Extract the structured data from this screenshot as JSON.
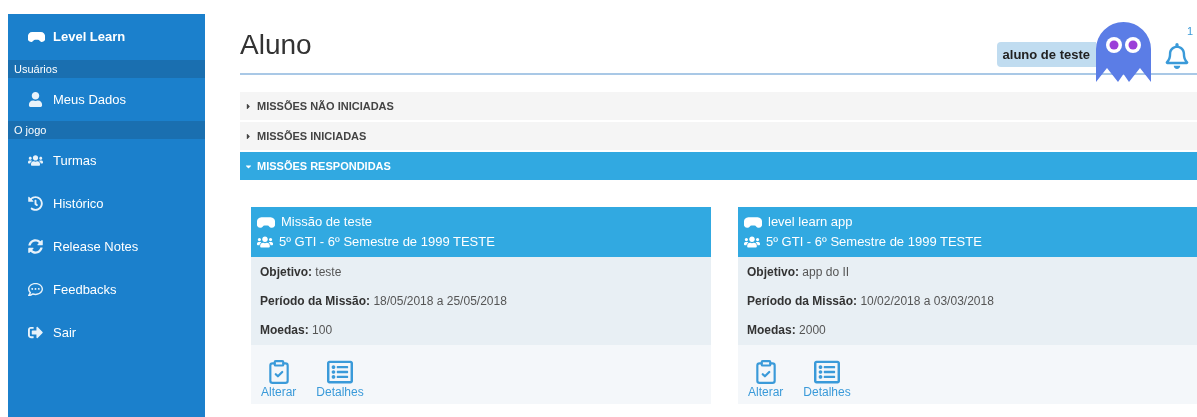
{
  "sidebar": {
    "brand": "Level Learn",
    "groups": [
      {
        "heading": "Usuários",
        "items": [
          {
            "label": "Meus Dados"
          }
        ]
      },
      {
        "heading": "O jogo",
        "items": [
          {
            "label": "Turmas"
          },
          {
            "label": "Histórico"
          },
          {
            "label": "Release Notes"
          },
          {
            "label": "Feedbacks"
          },
          {
            "label": "Sair"
          }
        ]
      }
    ]
  },
  "page_title": "Aluno",
  "header": {
    "user_name": "aluno de teste",
    "notification_count": "1"
  },
  "sections": [
    {
      "label": "MISSÕES NÃO INICIADAS",
      "expanded": false
    },
    {
      "label": "MISSÕES INICIADAS",
      "expanded": false
    },
    {
      "label": "MISSÕES RESPONDIDAS",
      "expanded": true
    }
  ],
  "missions": [
    {
      "title": "Missão de teste",
      "class": "5º GTI - 6º Semestre de 1999 TESTE",
      "fields": [
        {
          "label": "Objetivo:",
          "value": "teste"
        },
        {
          "label": "Período da Missão:",
          "value": "18/05/2018 a 25/05/2018"
        },
        {
          "label": "Moedas:",
          "value": "100"
        }
      ],
      "actions": [
        "Alterar",
        "Detalhes"
      ]
    },
    {
      "title": "level learn app",
      "class": "5º GTI - 6º Semestre de 1999 TESTE",
      "fields": [
        {
          "label": "Objetivo:",
          "value": "app do II"
        },
        {
          "label": "Período da Missão:",
          "value": "10/02/2018 a 03/03/2018"
        },
        {
          "label": "Moedas:",
          "value": "2000"
        }
      ],
      "actions": [
        "Alterar",
        "Detalhes"
      ]
    }
  ]
}
